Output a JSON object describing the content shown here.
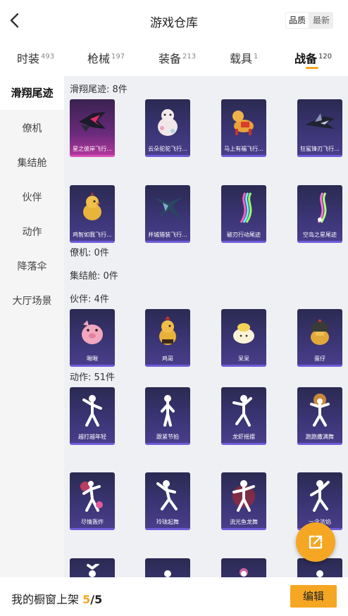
{
  "header": {
    "title": "游戏仓库",
    "sort_options": [
      "品质",
      "最新"
    ],
    "active_sort": "品质"
  },
  "tabs": [
    {
      "label": "时装",
      "count": "493"
    },
    {
      "label": "枪械",
      "count": "197"
    },
    {
      "label": "装备",
      "count": "213"
    },
    {
      "label": "载具",
      "count": "1"
    },
    {
      "label": "战备",
      "count": "120"
    }
  ],
  "sidebar": {
    "items": [
      "滑翔尾迹",
      "僚机",
      "集结舱",
      "伙伴",
      "动作",
      "降落伞",
      "大厅场景"
    ],
    "active": "滑翔尾迹"
  },
  "sections": {
    "glide": {
      "label": "滑翔尾迹: 8件",
      "items": [
        "星之彼岸飞行...",
        "云朵驼驼飞行...",
        "马上有福飞行...",
        "狂鲨锋刃飞行...",
        "鸡智如我飞行...",
        "并城猎装飞行...",
        "破刃行动尾迹",
        "空岛之星尾迹"
      ]
    },
    "wingman": {
      "label": "僚机: 0件"
    },
    "pod": {
      "label": "集结舱: 0件"
    },
    "partner": {
      "label": "伙伴: 4件",
      "items": [
        "啾啾",
        "鸡哥",
        "呆呆",
        "蛋仔"
      ]
    },
    "emote": {
      "label": "动作: 51件",
      "items": [
        "越打越年轻",
        "跟紧节拍",
        "龙虾摇摆",
        "跑跑撒满舞",
        "尽情轰炸",
        "玲珑起舞",
        "流光鱼龙舞",
        "一念浓焰",
        "",
        "",
        "",
        ""
      ]
    }
  },
  "bottom": {
    "prefix": "我的橱窗上架 ",
    "current": "5",
    "total": "/5",
    "edit_label": "编辑"
  },
  "colors": {
    "accent": "#f5a623",
    "card_top": "#2b2a52",
    "card_bottom": "#4a3e8c",
    "card_bar": "#6e5bd8",
    "highlight_card": "#b8389f"
  }
}
